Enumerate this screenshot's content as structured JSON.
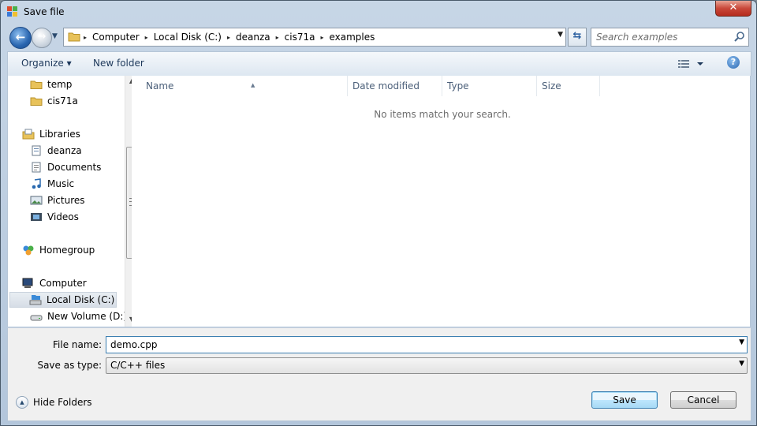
{
  "window": {
    "title": "Save file",
    "close_glyph": "✕"
  },
  "address": {
    "breadcrumbs": [
      "Computer",
      "Local Disk (C:)",
      "deanza",
      "cis71a",
      "examples"
    ],
    "separator": "▸"
  },
  "search": {
    "placeholder": "Search examples"
  },
  "toolbar": {
    "organize": "Organize ▾",
    "new_folder": "New folder",
    "help": "?"
  },
  "nav": {
    "items": [
      {
        "label": "temp",
        "icon": "folder-icon"
      },
      {
        "label": "cis71a",
        "icon": "folder-icon"
      },
      {
        "label": "Libraries",
        "icon": "libraries-icon"
      },
      {
        "label": "deanza",
        "icon": "library-document-icon"
      },
      {
        "label": "Documents",
        "icon": "documents-icon"
      },
      {
        "label": "Music",
        "icon": "music-icon"
      },
      {
        "label": "Pictures",
        "icon": "pictures-icon"
      },
      {
        "label": "Videos",
        "icon": "videos-icon"
      },
      {
        "label": "Homegroup",
        "icon": "homegroup-icon"
      },
      {
        "label": "Computer",
        "icon": "computer-icon"
      },
      {
        "label": "Local Disk (C:)",
        "icon": "local-disk-icon",
        "selected": true
      },
      {
        "label": "New Volume (D:)",
        "icon": "drive-icon"
      }
    ]
  },
  "columns": [
    "Name",
    "Date modified",
    "Type",
    "Size"
  ],
  "content": {
    "empty_message": "No items match your search."
  },
  "form": {
    "file_name_label": "File name:",
    "file_name_value": "demo.cpp",
    "save_type_label": "Save as type:",
    "save_type_value": "C/C++ files"
  },
  "footer": {
    "hide_folders": "Hide Folders",
    "save": "Save",
    "cancel": "Cancel"
  },
  "colors": {
    "accent": "#3c7fb1",
    "close": "#c9483a",
    "folder": "#e8c25a"
  }
}
